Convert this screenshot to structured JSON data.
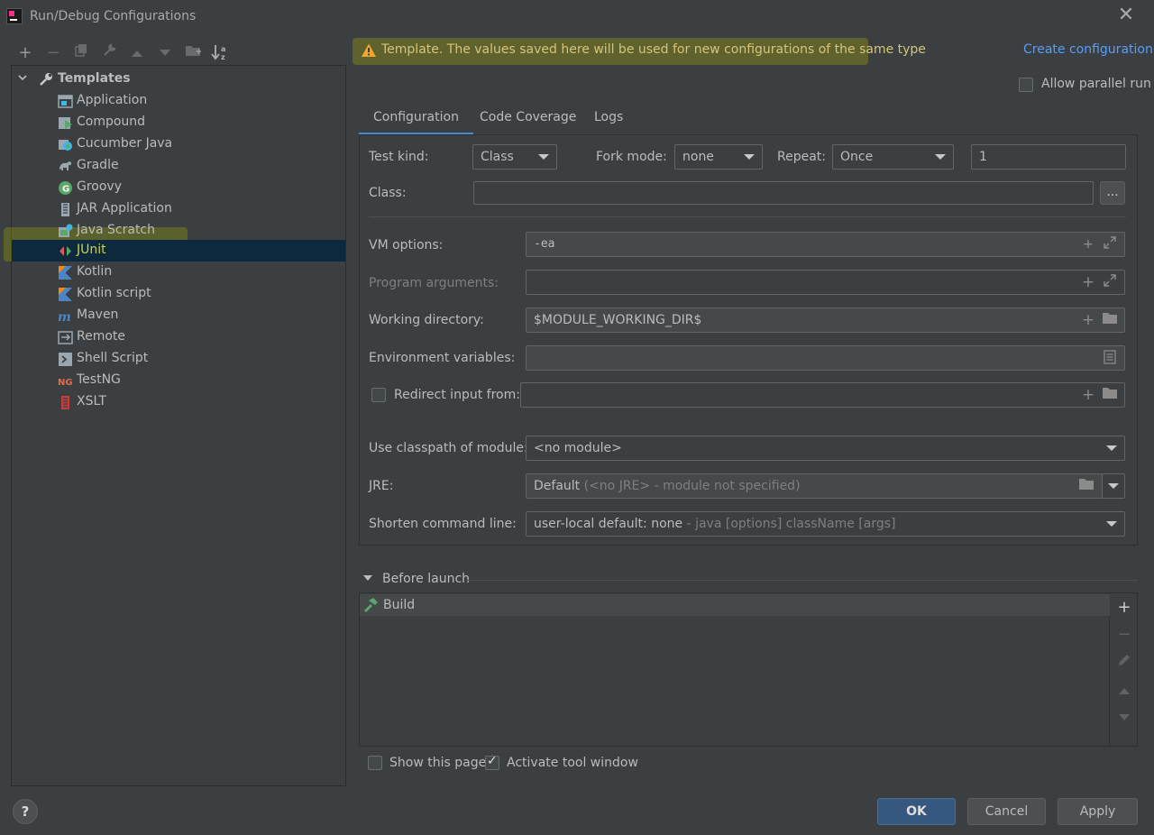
{
  "window": {
    "title": "Run/Debug Configurations",
    "close_label": "✕"
  },
  "toolbar": {
    "add": "+",
    "remove": "−",
    "sort_label": "↓a z"
  },
  "tree": {
    "root_label": "Templates",
    "items": [
      {
        "label": "Application",
        "icon": "application-icon"
      },
      {
        "label": "Compound",
        "icon": "compound-icon"
      },
      {
        "label": "Cucumber Java",
        "icon": "cucumber-java-icon"
      },
      {
        "label": "Gradle",
        "icon": "gradle-icon"
      },
      {
        "label": "Groovy",
        "icon": "groovy-icon"
      },
      {
        "label": "JAR Application",
        "icon": "jar-application-icon"
      },
      {
        "label": "Java Scratch",
        "icon": "java-scratch-icon"
      },
      {
        "label": "JUnit",
        "icon": "junit-icon"
      },
      {
        "label": "Kotlin",
        "icon": "kotlin-icon"
      },
      {
        "label": "Kotlin script",
        "icon": "kotlin-script-icon"
      },
      {
        "label": "Maven",
        "icon": "maven-icon"
      },
      {
        "label": "Remote",
        "icon": "remote-icon"
      },
      {
        "label": "Shell Script",
        "icon": "shell-script-icon"
      },
      {
        "label": "TestNG",
        "icon": "testng-icon"
      },
      {
        "label": "XSLT",
        "icon": "xslt-icon"
      }
    ],
    "selected": "JUnit"
  },
  "banner": {
    "text": "Template. The values saved here will be used for new configurations of the same type",
    "link": "Create configuration"
  },
  "allow_parallel": {
    "label": "Allow parallel run",
    "checked": false
  },
  "tabs": [
    "Configuration",
    "Code Coverage",
    "Logs"
  ],
  "active_tab": "Configuration",
  "form": {
    "test_kind_label": "Test kind:",
    "test_kind_value": "Class",
    "fork_mode_label": "Fork mode:",
    "fork_mode_value": "none",
    "repeat_label": "Repeat:",
    "repeat_value": "Once",
    "repeat_count": "1",
    "class_label": "Class:",
    "class_value": "",
    "browse_label": "...",
    "vm_options_label": "VM options:",
    "vm_options_value": "-ea",
    "program_args_label": "Program arguments:",
    "program_args_value": "",
    "working_dir_label": "Working directory:",
    "working_dir_value": "$MODULE_WORKING_DIR$",
    "env_vars_label": "Environment variables:",
    "env_vars_value": "",
    "redirect_label": "Redirect input from:",
    "redirect_value": "",
    "classpath_label": "Use classpath of module:",
    "classpath_value": "<no module>",
    "jre_label": "JRE:",
    "jre_value": "Default",
    "jre_hint": "(<no JRE> - module not specified)",
    "shorten_label": "Shorten command line:",
    "shorten_value": "user-local default: none",
    "shorten_hint": "- java [options] className [args]"
  },
  "before_launch": {
    "label": "Before launch",
    "tasks": [
      "Build"
    ]
  },
  "footer": {
    "show_page_label": "Show this page",
    "show_page_checked": false,
    "activate_tool_label": "Activate tool window",
    "activate_tool_checked": true,
    "help_label": "?",
    "ok_label": "OK",
    "cancel_label": "Cancel",
    "apply_label": "Apply"
  },
  "colors": {
    "background": "#3c3f41",
    "selection": "#0d293e",
    "link": "#589df6",
    "primary_button": "#365880",
    "banner_text": "#d4c47a"
  }
}
